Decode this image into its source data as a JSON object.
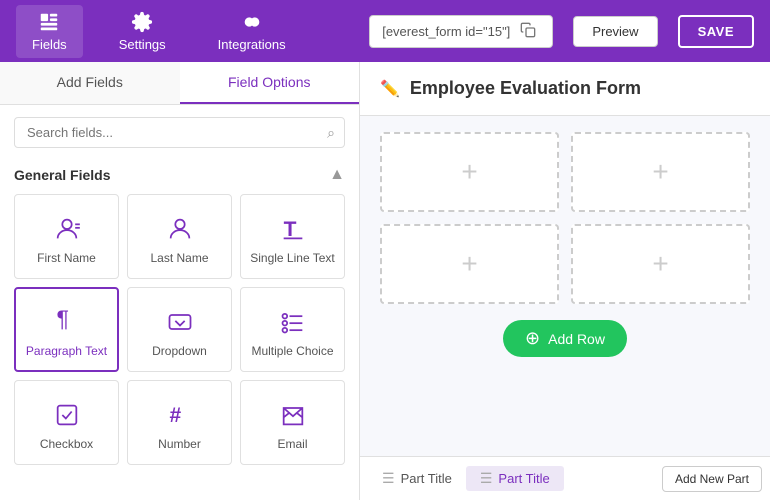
{
  "nav": {
    "items": [
      {
        "id": "fields",
        "label": "Fields",
        "active": true
      },
      {
        "id": "settings",
        "label": "Settings",
        "active": false
      },
      {
        "id": "integrations",
        "label": "Integrations",
        "active": false
      }
    ],
    "shortcode": "[everest_form id=\"15\"]",
    "preview_label": "Preview",
    "save_label": "SAVE"
  },
  "left_panel": {
    "tabs": [
      {
        "id": "add-fields",
        "label": "Add Fields",
        "active": false
      },
      {
        "id": "field-options",
        "label": "Field Options",
        "active": true
      }
    ],
    "search_placeholder": "Search fields...",
    "section_title": "General Fields",
    "fields": [
      {
        "id": "first-name",
        "label": "First Name",
        "icon": "person",
        "active": false
      },
      {
        "id": "last-name",
        "label": "Last Name",
        "icon": "person",
        "active": false
      },
      {
        "id": "single-line",
        "label": "Single Line Text",
        "icon": "T",
        "active": false
      },
      {
        "id": "paragraph",
        "label": "Paragraph Text",
        "icon": "paragraph",
        "active": true
      },
      {
        "id": "dropdown",
        "label": "Dropdown",
        "icon": "dropdown",
        "active": false
      },
      {
        "id": "multiple-choice",
        "label": "Multiple Choice",
        "icon": "list",
        "active": false
      },
      {
        "id": "checkbox",
        "label": "Checkbox",
        "icon": "check",
        "active": false
      },
      {
        "id": "number",
        "label": "Number",
        "icon": "hash",
        "active": false
      },
      {
        "id": "email",
        "label": "Email",
        "icon": "email",
        "active": false
      }
    ]
  },
  "right_panel": {
    "form_title": "Employee Evaluation Form",
    "rows": [
      {
        "id": "row1",
        "zones": 2
      },
      {
        "id": "row2",
        "zones": 2
      }
    ],
    "add_row_label": "Add Row",
    "bottom_tabs": [
      {
        "id": "part1",
        "label": "Part Title",
        "active": false
      },
      {
        "id": "part2",
        "label": "Part Title",
        "active": true
      }
    ],
    "add_part_label": "Add New Part"
  }
}
